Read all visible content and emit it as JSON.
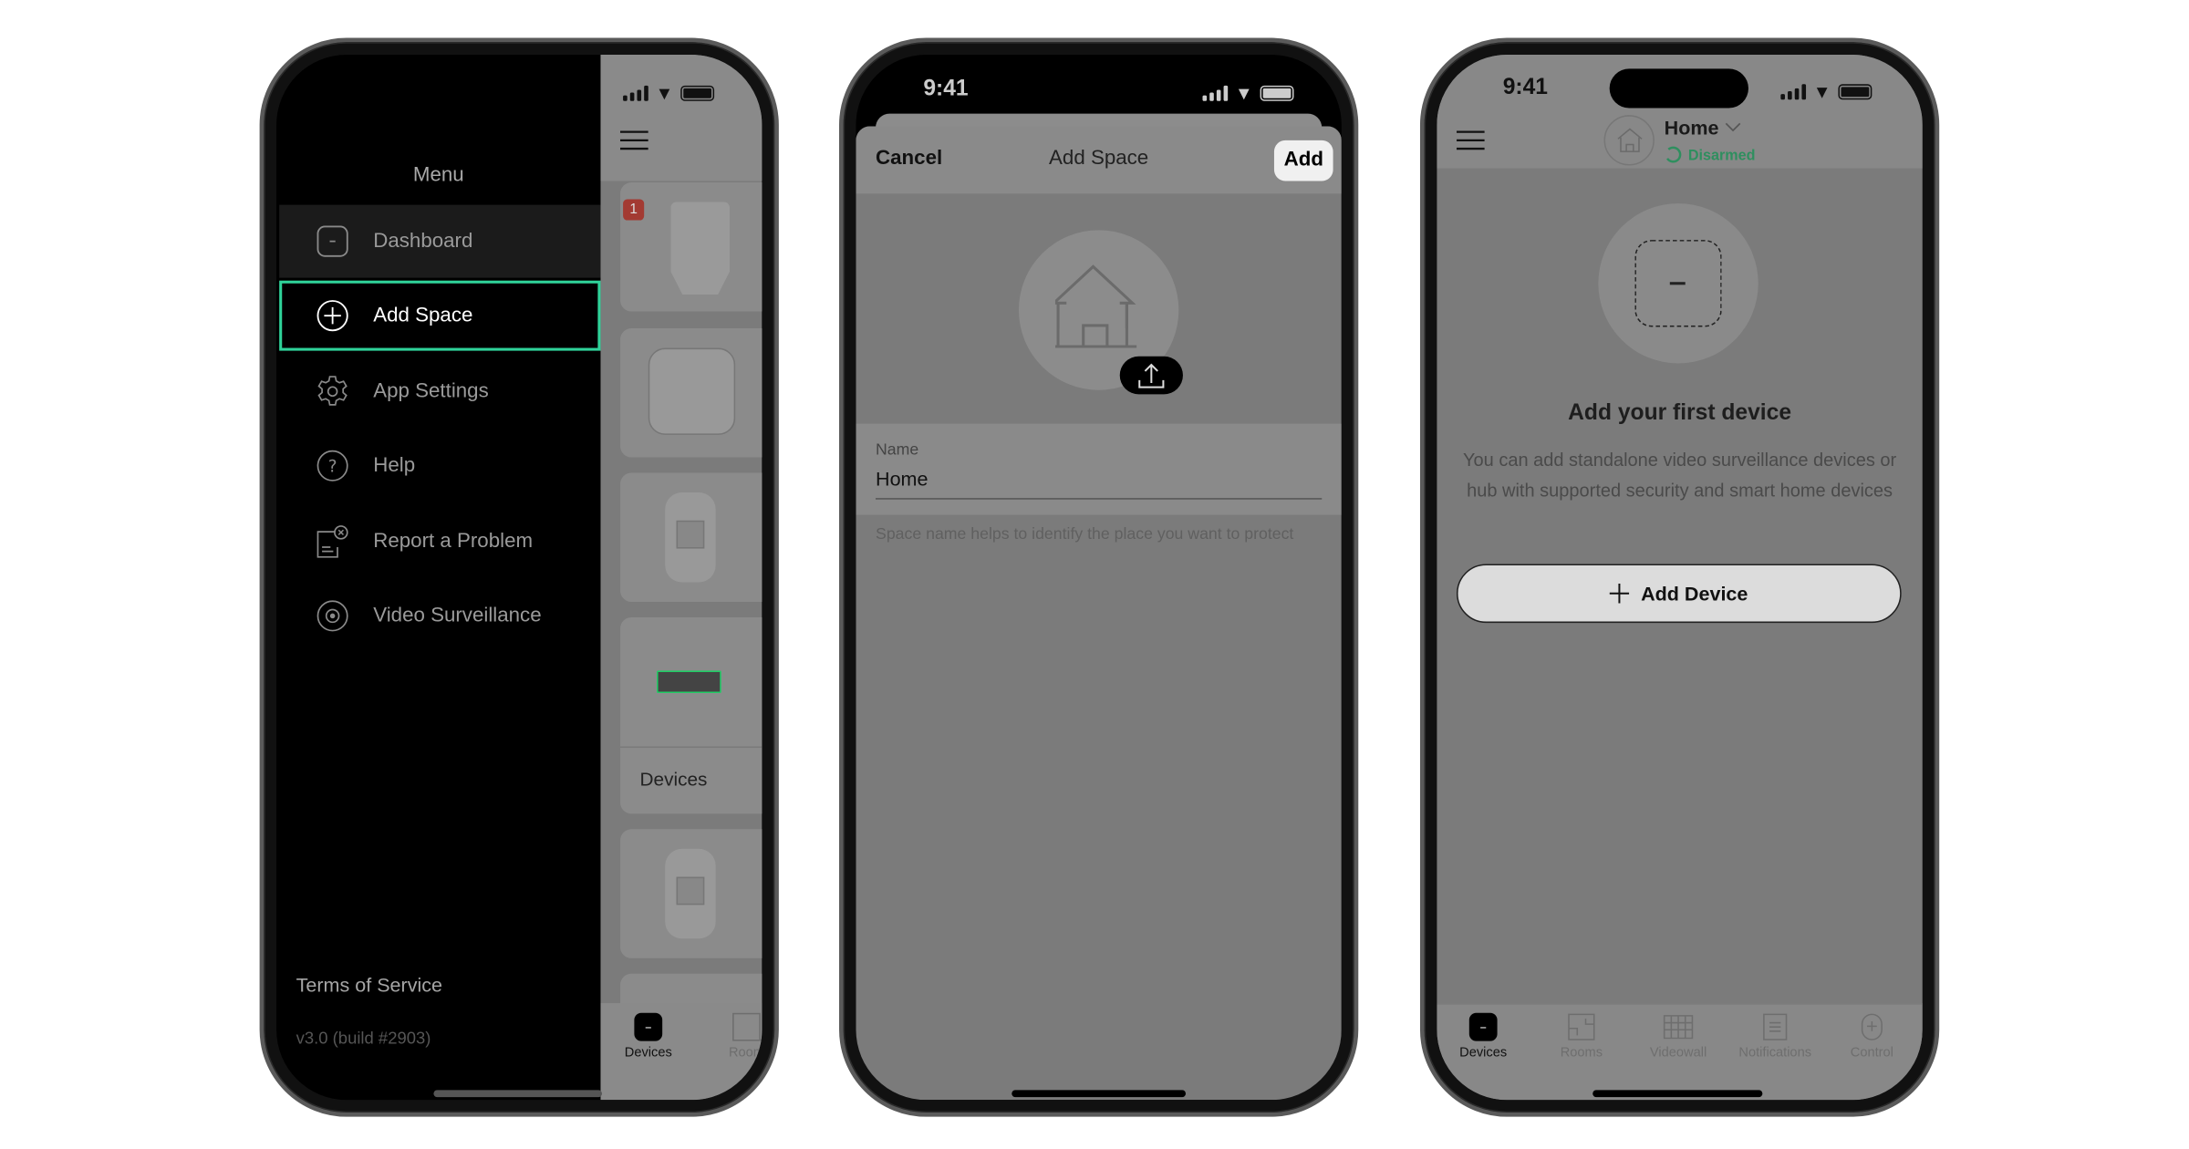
{
  "status_bar": {
    "time": "9:41"
  },
  "phone1": {
    "menu_title": "Menu",
    "items": [
      {
        "label": "Dashboard",
        "icon": "dashboard-icon"
      },
      {
        "label": "Add Space",
        "icon": "plus-circle-icon",
        "highlighted": true
      },
      {
        "label": "App Settings",
        "icon": "gear-icon"
      },
      {
        "label": "Help",
        "icon": "help-circle-icon"
      },
      {
        "label": "Report a Problem",
        "icon": "report-icon"
      },
      {
        "label": "Video Surveillance",
        "icon": "camera-icon"
      }
    ],
    "terms": "Terms of Service",
    "version": "v3.0 (build #2903)",
    "badge": "1",
    "group_label": "Devices",
    "tabs": [
      "Devices",
      "Room"
    ],
    "highlight_color": "#2fd39a"
  },
  "phone2": {
    "cancel": "Cancel",
    "title": "Add Space",
    "add": "Add",
    "name_label": "Name",
    "name_value": "Home",
    "helper": "Space name helps to identify the place you want to protect"
  },
  "phone3": {
    "space_name": "Home",
    "status": "Disarmed",
    "status_color": "#2f8f5f",
    "empty_title": "Add your first device",
    "empty_desc": "You can add standalone video surveillance devices or hub with supported security and smart home devices",
    "add_device": "Add Device",
    "tabs": [
      "Devices",
      "Rooms",
      "Videowall",
      "Notifications",
      "Control"
    ]
  }
}
